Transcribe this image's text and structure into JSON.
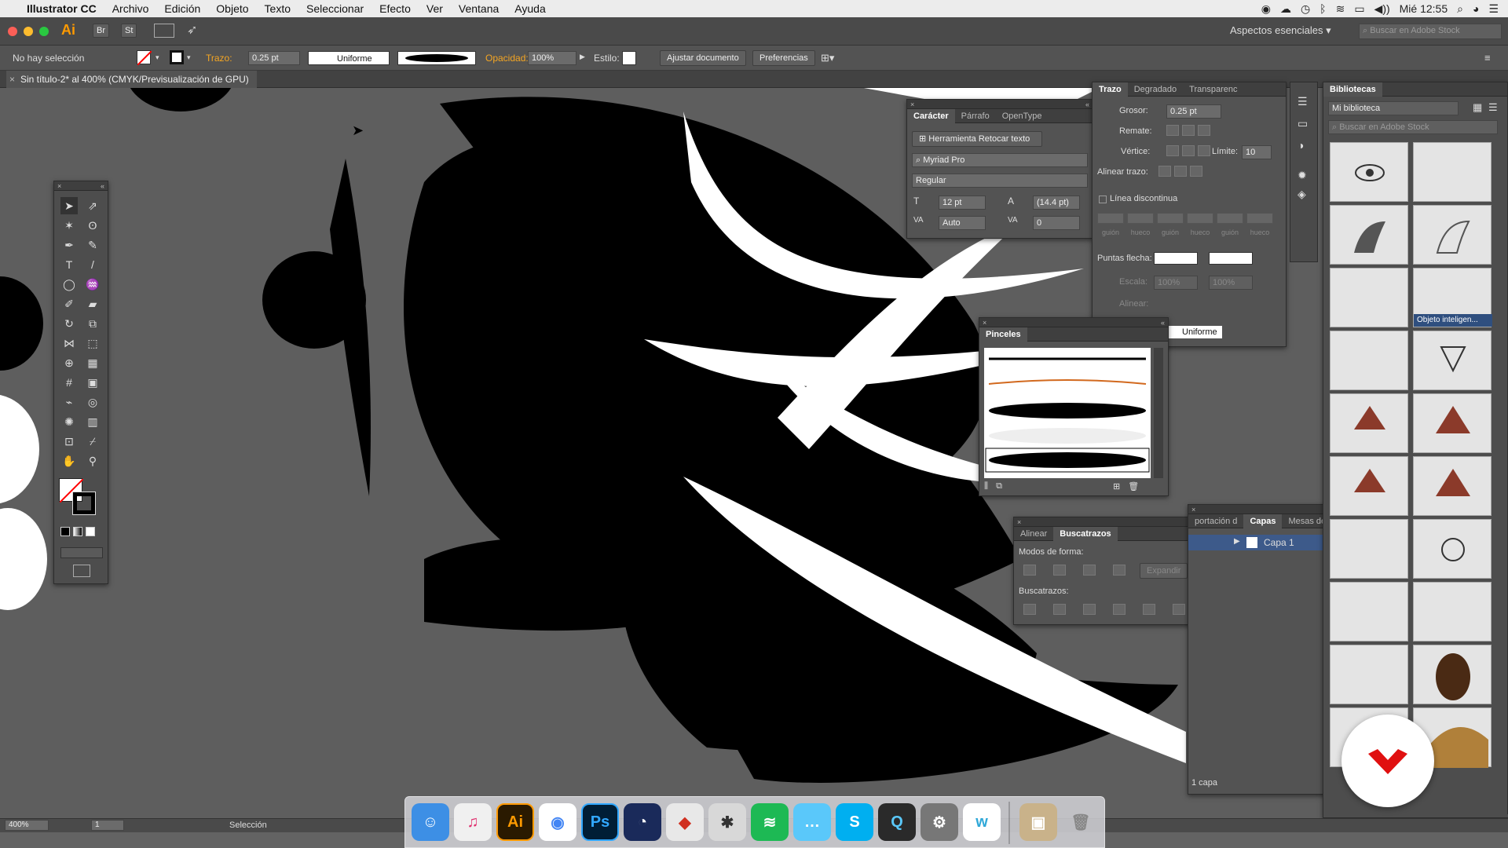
{
  "menubar": {
    "apple": "",
    "app": "Illustrator CC",
    "items": [
      "Archivo",
      "Edición",
      "Objeto",
      "Texto",
      "Seleccionar",
      "Efecto",
      "Ver",
      "Ventana",
      "Ayuda"
    ],
    "clock": "Mié 12:55"
  },
  "appbar": {
    "ai": "Ai",
    "br": "Br",
    "st": "St",
    "workspace": "Aspectos esenciales",
    "stock_search": "Buscar en Adobe Stock"
  },
  "control": {
    "selection": "No hay selección",
    "trazo_label": "Trazo:",
    "trazo_value": "0.25 pt",
    "profile": "Uniforme",
    "opacity_label": "Opacidad:",
    "opacity_value": "100%",
    "style_label": "Estilo:",
    "fit_button": "Ajustar documento",
    "prefs_button": "Preferencias"
  },
  "doc": {
    "tab": "Sin título-2* al 400% (CMYK/Previsualización de GPU)"
  },
  "character": {
    "tabs": [
      "Carácter",
      "Párrafo",
      "OpenType"
    ],
    "touch_tool": "Herramienta Retocar texto",
    "font": "Myriad Pro",
    "style": "Regular",
    "size": "12 pt",
    "leading": "(14.4 pt)",
    "kerning": "Auto",
    "tracking": "0"
  },
  "stroke": {
    "tabs": [
      "Trazo",
      "Degradado",
      "Transparenc"
    ],
    "weight_label": "Grosor:",
    "weight": "0.25 pt",
    "cap_label": "Remate:",
    "corner_label": "Vértice:",
    "limit_label": "Límite:",
    "limit": "10",
    "align_label": "Alinear trazo:",
    "dashed_label": "Línea discontinua",
    "dash_labels": [
      "guión",
      "hueco",
      "guión",
      "hueco",
      "guión",
      "hueco"
    ],
    "arrows_label": "Puntas flecha:",
    "scale_label": "Escala:",
    "scale1": "100%",
    "scale2": "100%",
    "align2_label": "Alinear:",
    "profile": "Uniforme"
  },
  "brushes": {
    "title": "Pinceles"
  },
  "pathfinder": {
    "tabs": [
      "Alinear",
      "Buscatrazos"
    ],
    "modes_label": "Modos de forma:",
    "expand": "Expandir",
    "finders_label": "Buscatrazos:"
  },
  "layers": {
    "tabs": [
      "portación d",
      "Capas",
      "Mesas de trab"
    ],
    "layer": "Capa 1",
    "count": "1 capa"
  },
  "libraries": {
    "title": "Bibliotecas",
    "library": "Mi biblioteca",
    "search": "Buscar en Adobe Stock",
    "smart_label": "Objeto inteligen..."
  },
  "status": {
    "zoom": "400%",
    "artboard": "1",
    "tool": "Selección"
  },
  "dock": {
    "apps": [
      "Finder",
      "iTunes",
      "Illustrator",
      "Chrome",
      "Photoshop",
      "Cinema 4D",
      "Sketchup",
      "Zbrush",
      "Spotify",
      "Messages",
      "Skype",
      "QuickTime",
      "Preferencias",
      "Wunderlist",
      "Photo",
      "Papelera"
    ],
    "ai": "Ai",
    "ps": "Ps",
    "s": "S"
  }
}
